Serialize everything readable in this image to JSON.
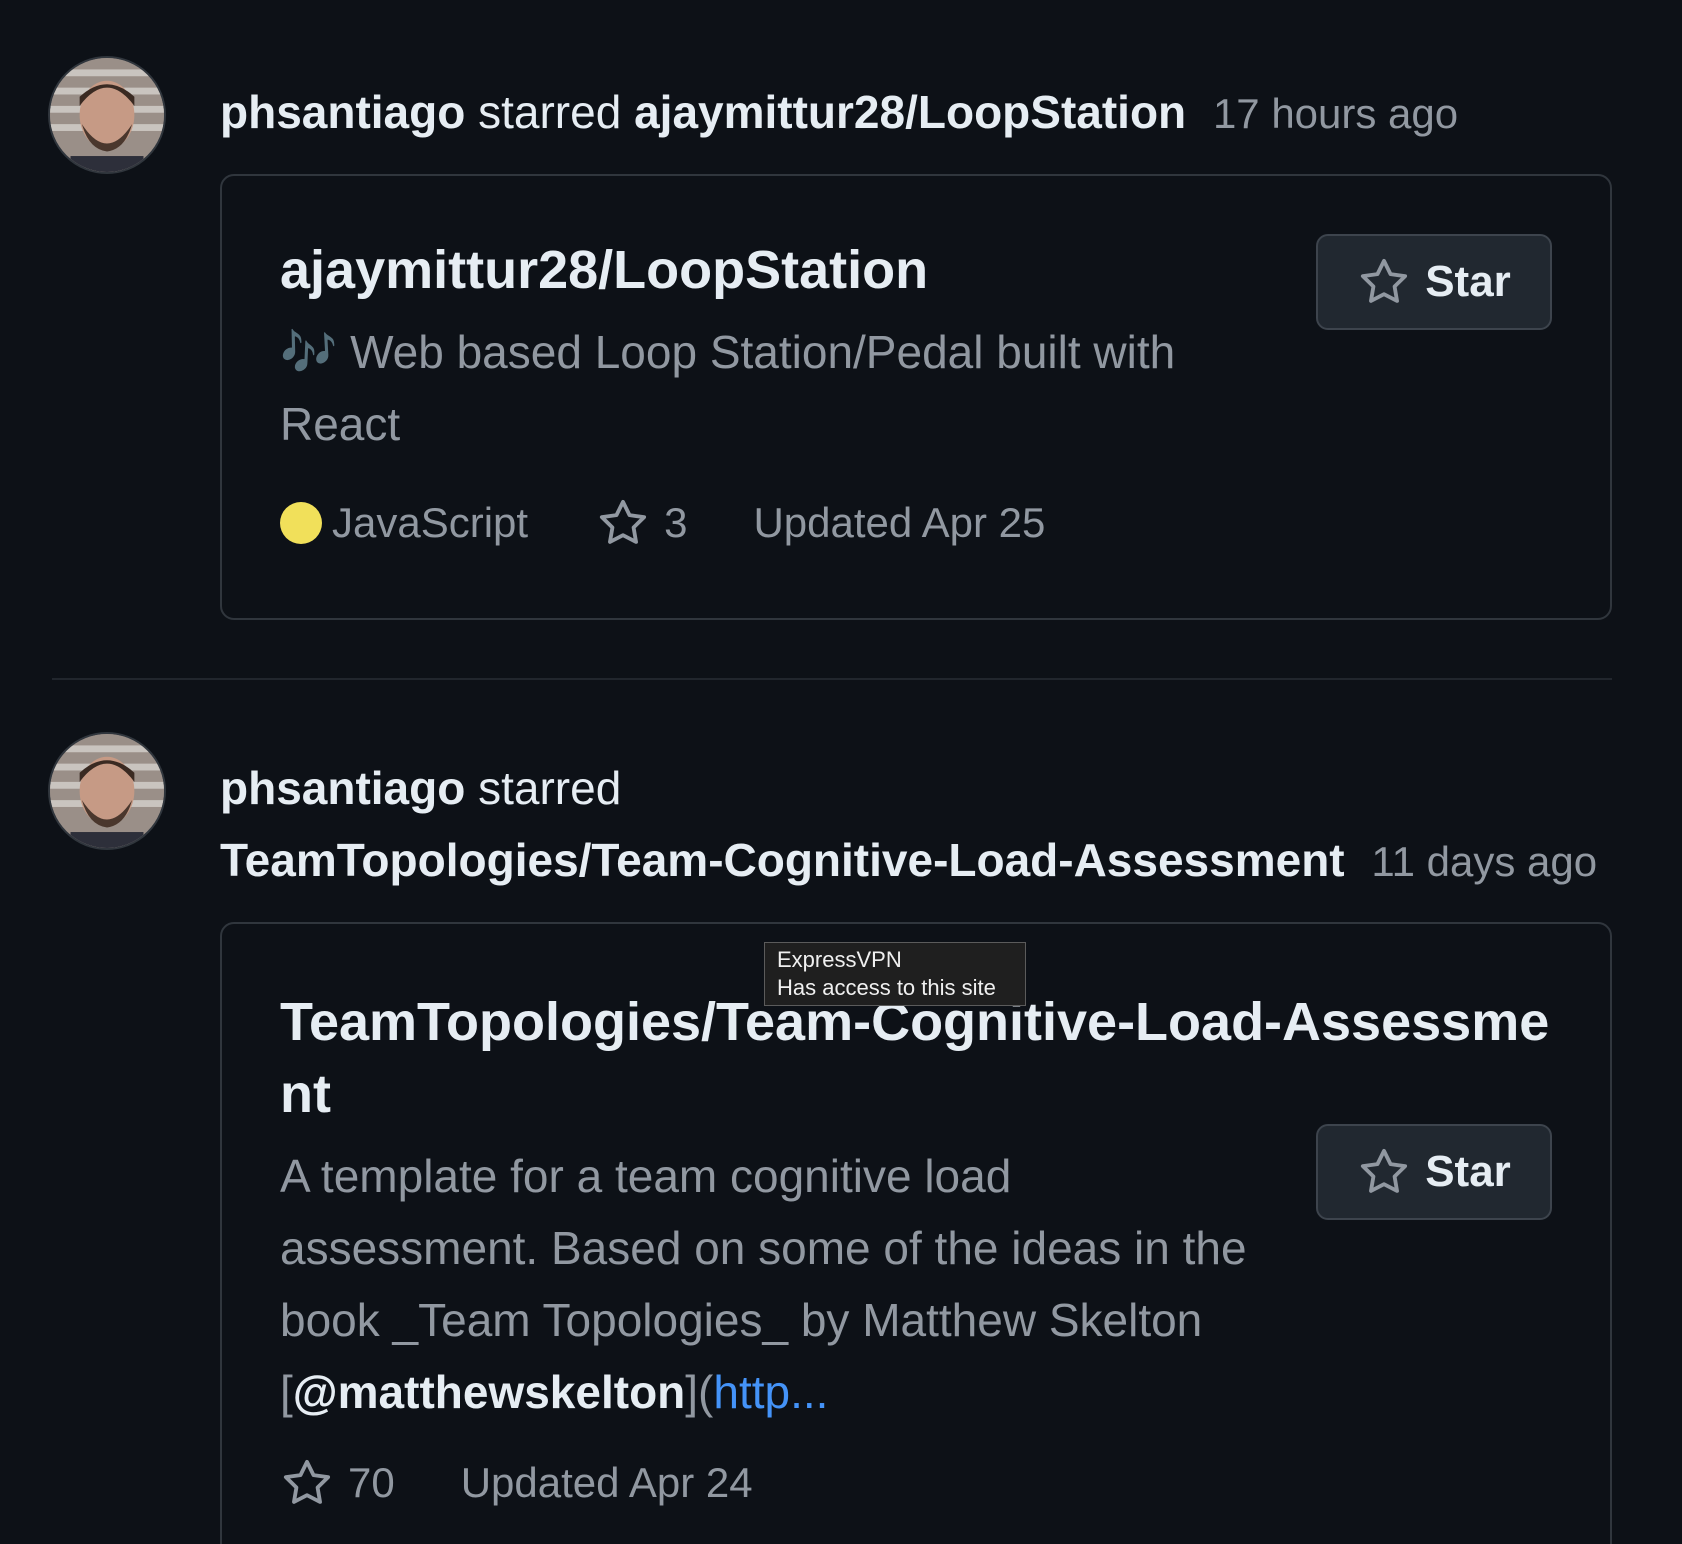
{
  "events": [
    {
      "actor": "phsantiago",
      "verb": "starred",
      "repo": "ajaymittur28/LoopStation",
      "time": "17 hours ago",
      "card": {
        "title": "ajaymittur28/LoopStation",
        "desc_emoji": "🎶",
        "description": "Web based Loop Station/Pedal built with React",
        "language": "JavaScript",
        "language_color": "#f1e05a",
        "stars": "3",
        "updated": "Updated Apr 25",
        "star_button_label": "Star",
        "star_icon": "star-outline-icon"
      }
    },
    {
      "actor": "phsantiago",
      "verb": "starred",
      "repo": "TeamTopologies/Team-Cognitive-Load-Assessment",
      "time": "11 days ago",
      "card": {
        "title": "TeamTopologies/Team-Cognitive-Load-Assessment",
        "description": "A template for a team cognitive load assessment. Based on some of the ideas in the book _Team Topologies_ by Matthew Skelton",
        "desc_bracket_open": "[",
        "desc_mention": "@matthewskelton",
        "desc_bracket_close": "](",
        "desc_link": "http...",
        "stars": "70",
        "updated": "Updated Apr 24",
        "star_button_label": "Star",
        "star_icon": "star-outline-icon"
      }
    }
  ],
  "tooltip": {
    "line1": "ExpressVPN",
    "line2": "Has access to this site"
  },
  "colors": {
    "background": "#0d1117",
    "border": "#30363d",
    "text_primary": "#e6edf3",
    "text_muted": "#9198a1",
    "link": "#4493f8",
    "button_bg": "#212830"
  }
}
